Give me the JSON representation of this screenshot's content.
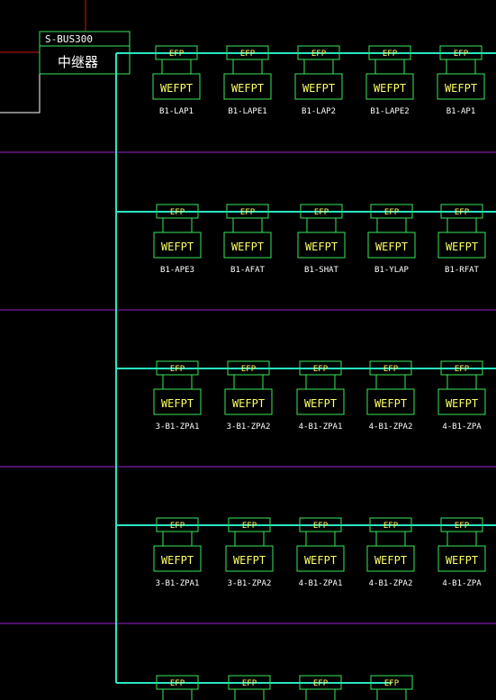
{
  "colors": {
    "bus": "#29e6c2",
    "box": "#39e85a",
    "label": "#ffffff",
    "box_text": "#ffff66",
    "divider": "#a020d0",
    "red": "#d01818",
    "white": "#ffffff"
  },
  "repeater": {
    "model": "S-BUS300",
    "name": "中继器"
  },
  "module_top_label": "EFP",
  "module_body_label": "WEFPT",
  "rows": [
    {
      "labels": [
        "B1-LAP1",
        "B1-LAPE1",
        "B1-LAP2",
        "B1-LAPE2",
        "B1-AP1"
      ]
    },
    {
      "labels": [
        "B1-APE3",
        "B1-AFAT",
        "B1-SHAT",
        "B1-YLAP",
        "B1-RFAT"
      ]
    },
    {
      "labels": [
        "3-B1-ZPA1",
        "3-B1-ZPA2",
        "4-B1-ZPA1",
        "4-B1-ZPA2",
        "4-B1-ZPA"
      ]
    },
    {
      "labels": [
        "3-B1-ZPA1",
        "3-B1-ZPA2",
        "4-B1-ZPA1",
        "4-B1-ZPA2",
        "4-B1-ZPA"
      ]
    },
    {
      "labels": [
        "",
        "",
        "",
        ""
      ]
    }
  ]
}
